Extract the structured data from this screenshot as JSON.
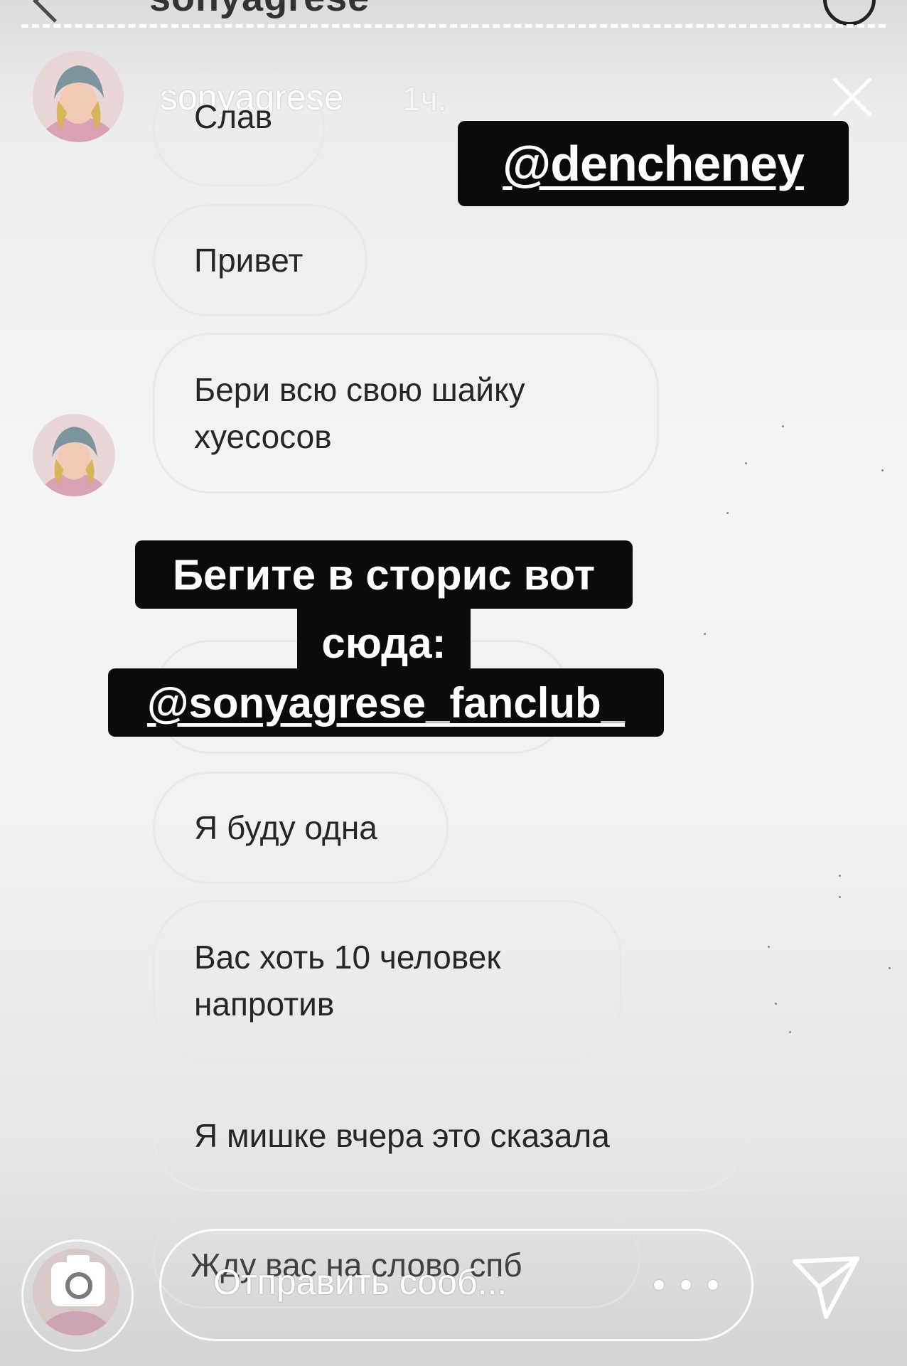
{
  "chat_header": {
    "title": "sonyagrese"
  },
  "story": {
    "username": "sonyagrese",
    "time": "1ч."
  },
  "messages": [
    {
      "text": "Слав"
    },
    {
      "text": "Привет"
    },
    {
      "text": "Бери всю свою шайку хуесосов"
    },
    {
      "text": "Я буду одна"
    },
    {
      "text": "Вас хоть 10 человек напротив"
    },
    {
      "text": "Я мишке вчера это сказала"
    },
    {
      "text": "Жду вас на слово спб"
    }
  ],
  "stickers": {
    "top_mention": "@dencheney",
    "caption_line1": "Бегите в сторис вот",
    "caption_line2": "сюда:",
    "caption_mention": "@sonyagrese_fanclub_"
  },
  "reply_bar": {
    "placeholder": "Отправить сооб..."
  },
  "icons": {
    "back": "chevron-left-icon",
    "info": "info-icon",
    "close": "close-icon",
    "camera": "camera-icon",
    "more": "more-horizontal-icon",
    "send": "send-icon"
  },
  "colors": {
    "sticker_bg": "#0b0b0b",
    "sticker_text": "#ffffff",
    "bubble_border": "#e8e8e8",
    "text": "#262626"
  }
}
